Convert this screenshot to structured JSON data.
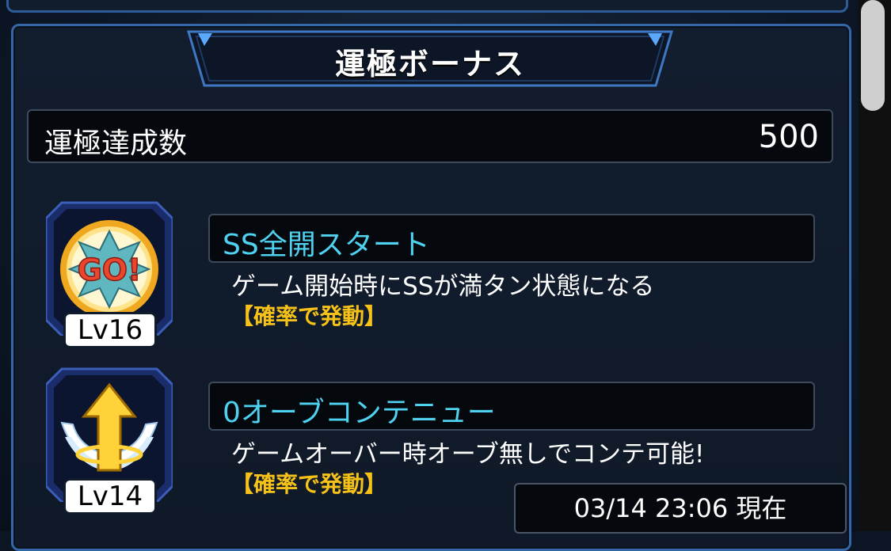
{
  "panel": {
    "title": "運極ボーナス"
  },
  "stats": {
    "label": "運極達成数",
    "value": "500"
  },
  "abilities": [
    {
      "icon": "go-burst-icon",
      "level": "Lv16",
      "name": "SS全開スタート",
      "description": "ゲーム開始時にSSが満タン状態になる",
      "note": "【確率で発動】"
    },
    {
      "icon": "winged-arrow-icon",
      "level": "Lv14",
      "name": "0オーブコンテニュー",
      "description": "ゲームオーバー時オーブ無しでコンテ可能!",
      "note": "【確率で発動】"
    }
  ],
  "timestamp": "03/14 23:06 現在",
  "colors": {
    "accent_blue": "#3566a8",
    "ability_name": "#4fd2f0",
    "note_yellow": "#f6c219"
  }
}
